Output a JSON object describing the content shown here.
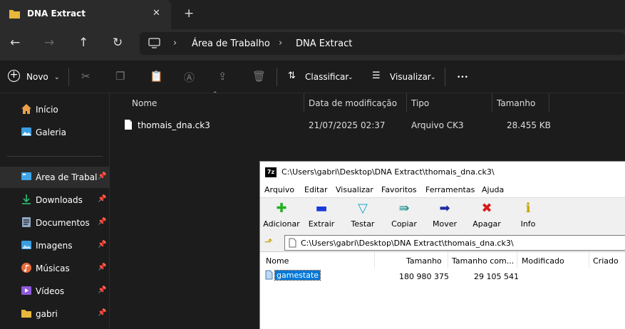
{
  "tab": {
    "title": "DNA Extract",
    "close": "✕",
    "new": "+"
  },
  "nav": {
    "back": "←",
    "forward": "→",
    "up": "↑",
    "refresh": "↻",
    "breadcrumb": [
      "Área de Trabalho",
      "DNA Extract"
    ],
    "sep": "›"
  },
  "toolbar": {
    "new_label": "Novo",
    "sort_label": "Classificar",
    "view_label": "Visualizar",
    "more": "•••"
  },
  "sidebar": {
    "items": [
      {
        "label": "Início",
        "icon": "home-icon",
        "color": "#e8a04a"
      },
      {
        "label": "Galeria",
        "icon": "gallery-icon",
        "color": "#3a9de0"
      },
      {
        "label": "Área de Trabalho",
        "icon": "desktop-icon",
        "color": "#41a5e8",
        "pinned": true
      },
      {
        "label": "Downloads",
        "icon": "downloads-icon",
        "color": "#2fb36f",
        "pinned": true
      },
      {
        "label": "Documentos",
        "icon": "documents-icon",
        "color": "#8fa7c2",
        "pinned": true
      },
      {
        "label": "Imagens",
        "icon": "pictures-icon",
        "color": "#3a9de0",
        "pinned": true
      },
      {
        "label": "Músicas",
        "icon": "music-icon",
        "color": "#e76b3c",
        "pinned": true
      },
      {
        "label": "Vídeos",
        "icon": "videos-icon",
        "color": "#8e5ad8",
        "pinned": true
      },
      {
        "label": "gabri",
        "icon": "folder-icon",
        "color": "#e8b83c",
        "pinned": true
      }
    ],
    "pin": "📌"
  },
  "files": {
    "columns": [
      "Nome",
      "Data de modificação",
      "Tipo",
      "Tamanho"
    ],
    "rows": [
      {
        "name": "thomais_dna.ck3",
        "date": "21/07/2025 02:37",
        "type": "Arquivo CK3",
        "size": "28.455 KB"
      }
    ]
  },
  "zip": {
    "title": "C:\\Users\\gabri\\Desktop\\DNA Extract\\thomais_dna.ck3\\",
    "menu": [
      "Arquivo",
      "Editar",
      "Visualizar",
      "Favoritos",
      "Ferramentas",
      "Ajuda"
    ],
    "tools": [
      {
        "label": "Adicionar",
        "glyph": "✚",
        "color": "#22b022"
      },
      {
        "label": "Extrair",
        "glyph": "▬",
        "color": "#1a3ad8"
      },
      {
        "label": "Testar",
        "glyph": "▽",
        "color": "#1aa8c8"
      },
      {
        "label": "Copiar",
        "glyph": "⇛",
        "color": "#1a8a8a"
      },
      {
        "label": "Mover",
        "glyph": "➡",
        "color": "#1a2aa0"
      },
      {
        "label": "Apagar",
        "glyph": "✖",
        "color": "#d81a1a"
      },
      {
        "label": "Info",
        "glyph": "ℹ",
        "color": "#c8a000"
      }
    ],
    "path": "C:\\Users\\gabri\\Desktop\\DNA Extract\\thomais_dna.ck3\\",
    "columns": [
      "Nome",
      "Tamanho",
      "Tamanho com...",
      "Modificado",
      "Criado"
    ],
    "rows": [
      {
        "name": "gamestate",
        "size": "180 980 375",
        "packed": "29 105 541"
      }
    ]
  }
}
